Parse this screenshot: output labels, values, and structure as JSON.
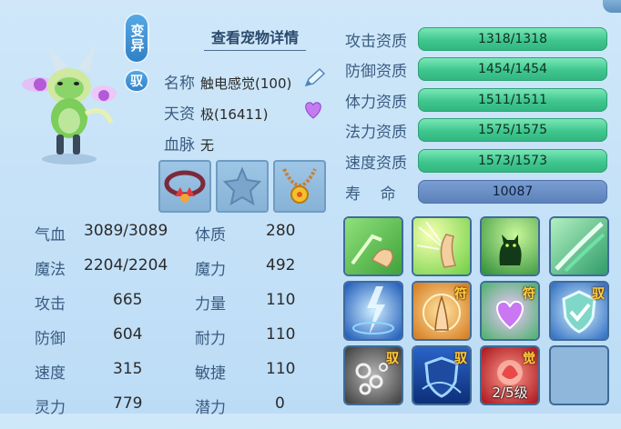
{
  "pet_panel": {
    "mutation_tag": "变异",
    "tamed_tag": "驭",
    "detail_link": "查看宠物详情",
    "name_label": "名称",
    "name_value": "触电感觉(100)",
    "talent_label": "天资",
    "talent_value": "极(16411)",
    "bloodline_label": "血脉",
    "bloodline_value": "无"
  },
  "stats": [
    {
      "l1": "气血",
      "v1": "3089/3089",
      "l2": "体质",
      "v2": "280"
    },
    {
      "l1": "魔法",
      "v1": "2204/2204",
      "l2": "魔力",
      "v2": "492"
    },
    {
      "l1": "攻击",
      "v1": "665",
      "l2": "力量",
      "v2": "110"
    },
    {
      "l1": "防御",
      "v1": "604",
      "l2": "耐力",
      "v2": "110"
    },
    {
      "l1": "速度",
      "v1": "315",
      "l2": "敏捷",
      "v2": "110"
    },
    {
      "l1": "灵力",
      "v1": "779",
      "l2": "潜力",
      "v2": "0"
    }
  ],
  "aptitudes": [
    {
      "label": "攻击资质",
      "value": "1318/1318"
    },
    {
      "label": "防御资质",
      "value": "1454/1454"
    },
    {
      "label": "体力资质",
      "value": "1511/1511"
    },
    {
      "label": "法力资质",
      "value": "1575/1575"
    },
    {
      "label": "速度资质",
      "value": "1573/1573"
    }
  ],
  "lifespan": {
    "label": "寿    命",
    "value": "10087"
  },
  "skills": {
    "badge_fu": "符",
    "badge_yu": "驭",
    "badge_jue": "觉",
    "awaken_level": "2/5级"
  },
  "colors": {
    "bar_green": "#3fc68e",
    "bar_blue": "#5b80b8",
    "panel_bg": "#bcdcf6",
    "label": "#3b5c82"
  },
  "icons": [
    "pen-icon",
    "heart-icon",
    "necklace-equip",
    "empty-equip",
    "amulet-equip"
  ]
}
